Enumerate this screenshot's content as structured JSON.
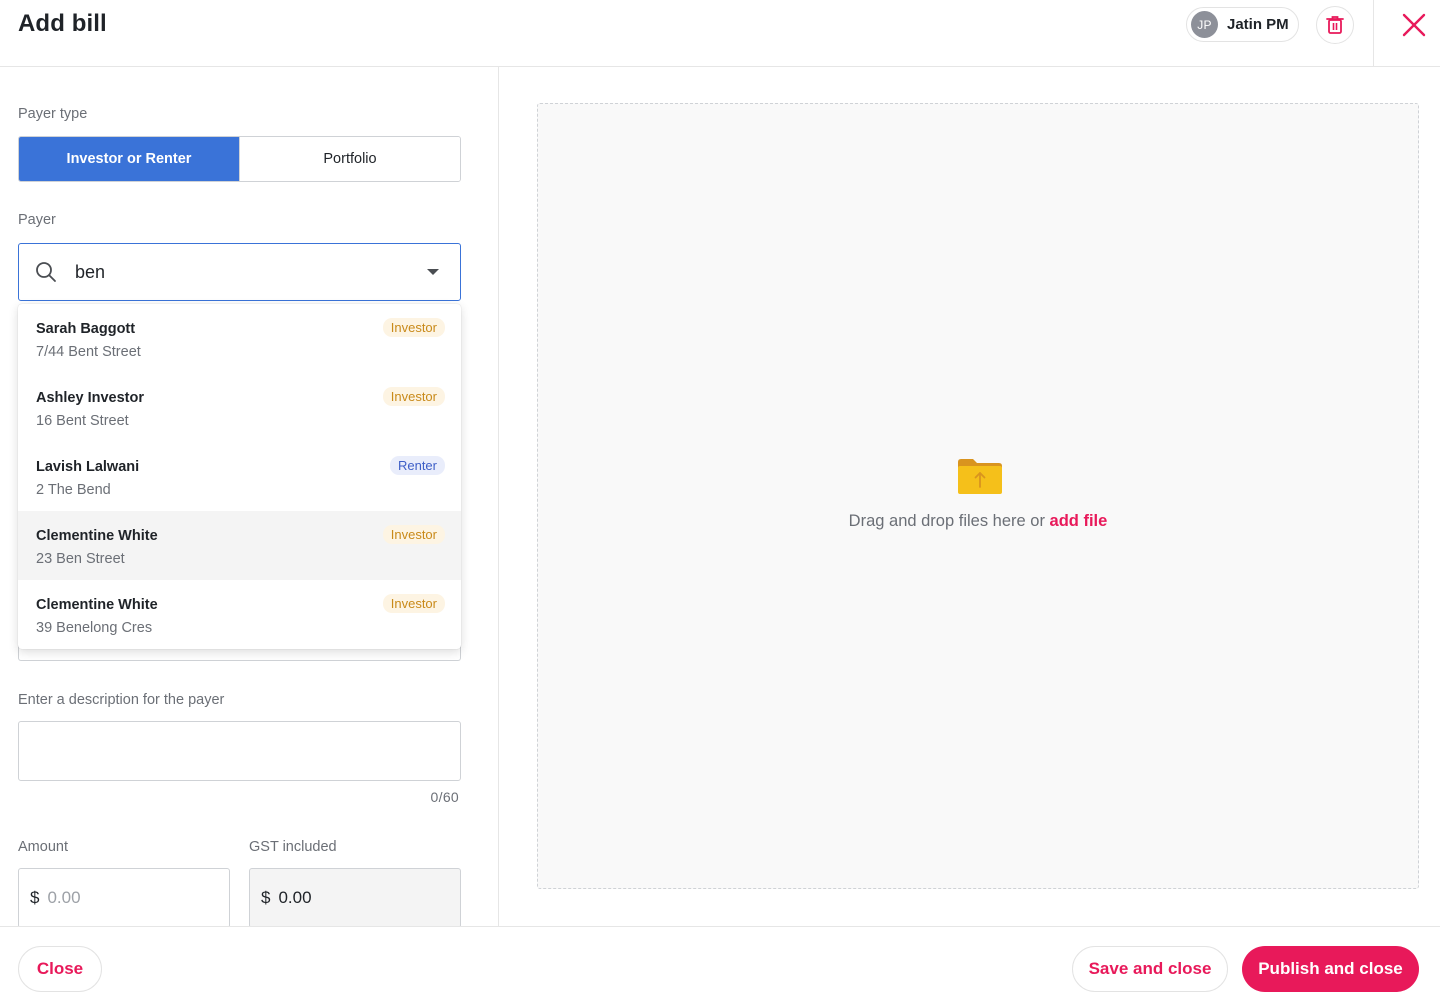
{
  "header": {
    "title": "Add bill",
    "user": {
      "initials": "JP",
      "name": "Jatin PM"
    },
    "delete_icon": "trash-icon",
    "close_icon": "close-icon"
  },
  "form": {
    "payer_type": {
      "label": "Payer type",
      "options": [
        "Investor or Renter",
        "Portfolio"
      ],
      "selected": "Investor or Renter"
    },
    "payer": {
      "label": "Payer",
      "search_value": "ben",
      "results": [
        {
          "name": "Sarah Baggott",
          "address": "7/44 Bent Street",
          "type": "Investor"
        },
        {
          "name": "Ashley Investor",
          "address": "16 Bent Street",
          "type": "Investor"
        },
        {
          "name": "Lavish Lalwani",
          "address": "2 The Bend",
          "type": "Renter"
        },
        {
          "name": "Clementine White",
          "address": "23 Ben Street",
          "type": "Investor"
        },
        {
          "name": "Clementine White",
          "address": "39 Benelong Cres",
          "type": "Investor"
        }
      ]
    },
    "description": {
      "label": "Enter a description for the payer",
      "value": "",
      "counter": "0/60"
    },
    "amount": {
      "label": "Amount",
      "currency": "$",
      "placeholder": "0.00"
    },
    "gst": {
      "label": "GST included",
      "currency": "$",
      "value": "0.00"
    }
  },
  "upload": {
    "text": "Drag and drop files here or",
    "link": "add file"
  },
  "footer": {
    "close": "Close",
    "save": "Save and close",
    "publish": "Publish and close"
  },
  "colors": {
    "accent": "#e8195a",
    "primary_blue": "#3a73d8",
    "investor_badge": "#c98a1a",
    "renter_badge": "#3e5fc7"
  }
}
